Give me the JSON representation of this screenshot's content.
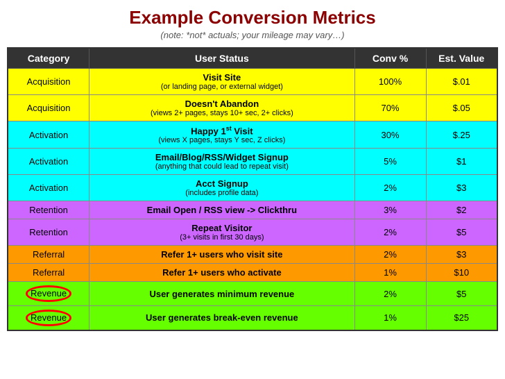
{
  "title": "Example Conversion Metrics",
  "subtitle": "(note: *not* actuals; your mileage may vary…)",
  "header": {
    "category": "Category",
    "status": "User Status",
    "conv": "Conv %",
    "value": "Est. Value"
  },
  "rows": [
    {
      "category": "Acquisition",
      "statusMain": "Visit Site",
      "statusSub": "(or landing page, or external widget)",
      "conv": "100%",
      "value": "$.01",
      "class": "row-acq1"
    },
    {
      "category": "Acquisition",
      "statusMain": "Doesn't Abandon",
      "statusSub": "(views 2+ pages, stays 10+ sec, 2+ clicks)",
      "conv": "70%",
      "value": "$.05",
      "class": "row-acq2"
    },
    {
      "category": "Activation",
      "statusMain": "Happy 1st Visit",
      "statusMainSup": "st",
      "statusSub": "(views X pages, stays Y sec, Z clicks)",
      "conv": "30%",
      "value": "$.25",
      "class": "row-act1"
    },
    {
      "category": "Activation",
      "statusMain": "Email/Blog/RSS/Widget Signup",
      "statusSub": "(anything that could lead to repeat visit)",
      "conv": "5%",
      "value": "$1",
      "class": "row-act2"
    },
    {
      "category": "Activation",
      "statusMain": "Acct Signup",
      "statusSub": "(includes profile data)",
      "conv": "2%",
      "value": "$3",
      "class": "row-act3"
    },
    {
      "category": "Retention",
      "statusMain": "Email Open / RSS view -> Clickthru",
      "statusSub": "",
      "conv": "3%",
      "value": "$2",
      "class": "row-ret1"
    },
    {
      "category": "Retention",
      "statusMain": "Repeat Visitor",
      "statusSub": "(3+ visits in first 30 days)",
      "conv": "2%",
      "value": "$5",
      "class": "row-ret2"
    },
    {
      "category": "Referral",
      "statusMain": "Refer 1+ users who visit site",
      "statusSub": "",
      "conv": "2%",
      "value": "$3",
      "class": "row-ref1"
    },
    {
      "category": "Referral",
      "statusMain": "Refer 1+ users who activate",
      "statusSub": "",
      "conv": "1%",
      "value": "$10",
      "class": "row-ref2"
    },
    {
      "category": "Revenue",
      "statusMain": "User generates minimum revenue",
      "statusSub": "",
      "conv": "2%",
      "value": "$5",
      "class": "row-rev1",
      "circleCategory": true
    },
    {
      "category": "Revenue",
      "statusMain": "User generates break-even revenue",
      "statusSub": "",
      "conv": "1%",
      "value": "$25",
      "class": "row-rev2",
      "circleCategory": true
    }
  ]
}
